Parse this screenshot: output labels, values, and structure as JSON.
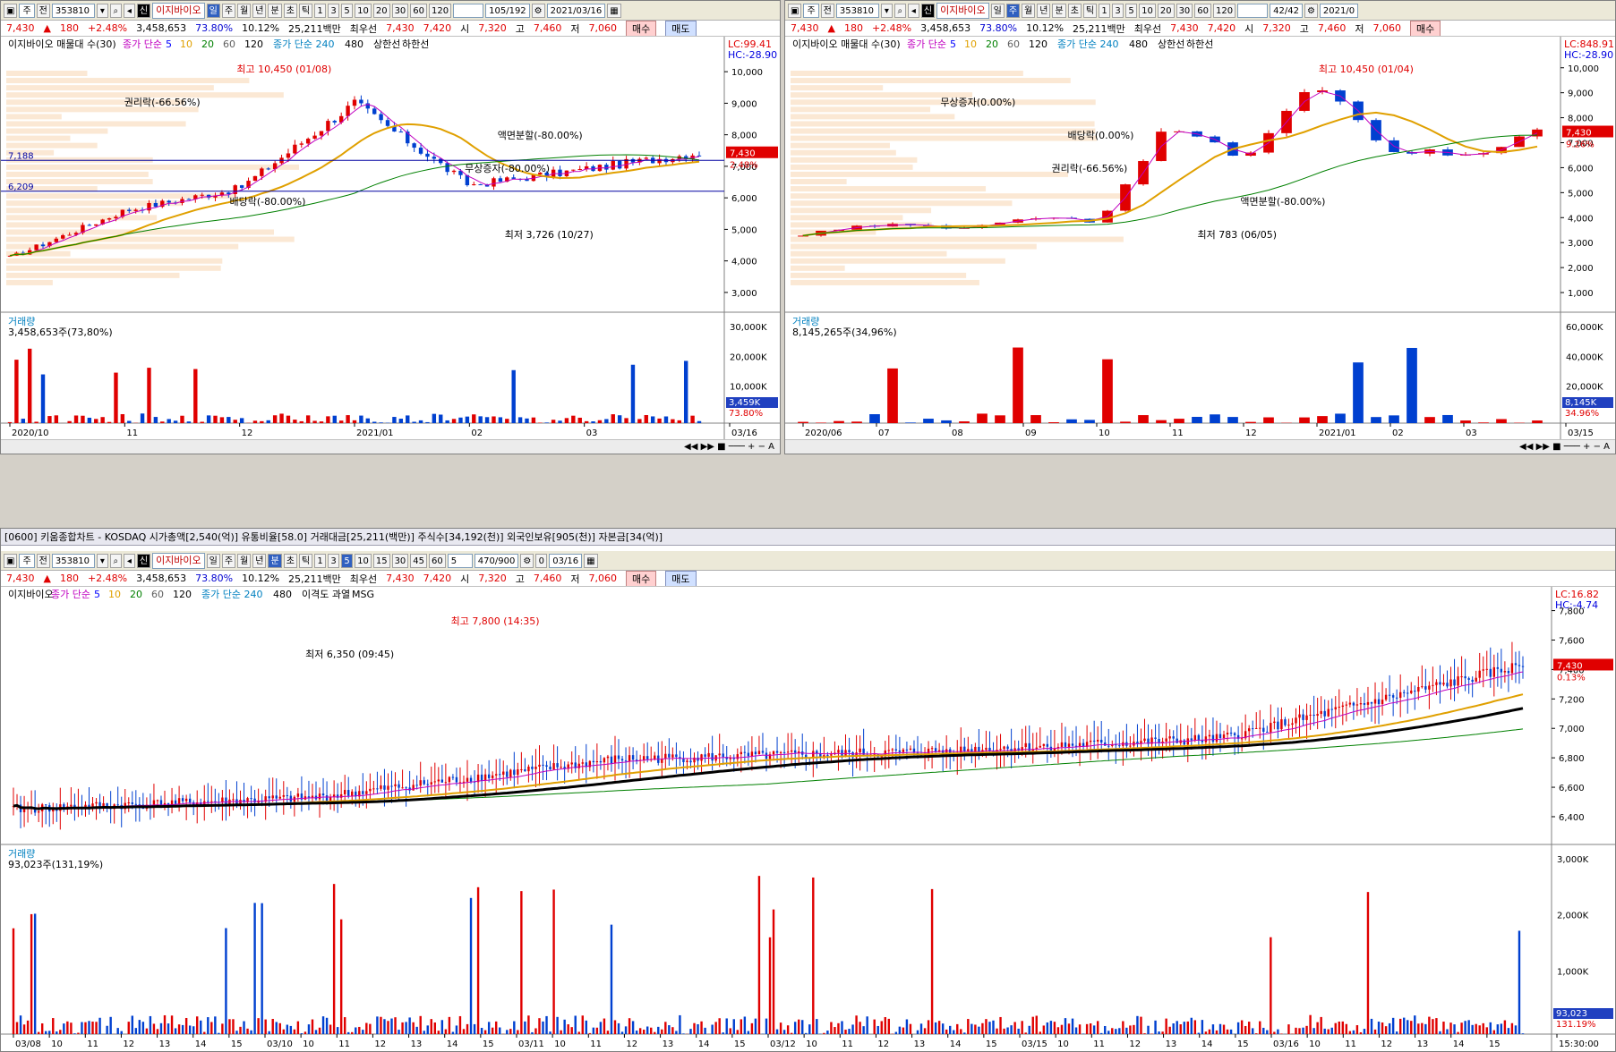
{
  "common": {
    "toolbar_select": "주",
    "toolbar_all": "전",
    "code": "353810",
    "ticker_name": "이지바이오",
    "new_badge": "신",
    "periods": [
      "일",
      "주",
      "월",
      "년",
      "분",
      "초",
      "틱"
    ],
    "numbers_daily": [
      "1",
      "3",
      "5",
      "10",
      "20",
      "30",
      "60",
      "120"
    ],
    "price": "7,430",
    "price_arrow": "▲",
    "change": "180",
    "change_pct": "+2.48%",
    "volume": "3,458,653",
    "vol_ratio": "73.80%",
    "turnover_pct": "10.12%",
    "amount": "25,211백만",
    "priority_label": "최우선",
    "bid": "7,430",
    "ask": "7,420",
    "open_label": "시",
    "open": "7,320",
    "high_label": "고",
    "high": "7,460",
    "low_label": "저",
    "low": "7,060",
    "buy": "매수",
    "sell": "매도"
  },
  "panes": {
    "left": {
      "counter": "105/192",
      "date": "2021/03/16",
      "legend": [
        "이지바이오 매물대 수(30)",
        "종가 단순",
        "5",
        "10",
        "20",
        "60",
        "120",
        "종가 단순 240",
        "480",
        "상한선",
        "하한선"
      ],
      "lc": "LC:99.41",
      "hc": "HC:-28.90",
      "vol_label": "거래량",
      "vol_value": "3,458,653주(73,80%)",
      "vol_side": "3,459K",
      "vol_pct": "73.80%",
      "level1": "7,188",
      "level2": "6,209",
      "cur_price": "7,430",
      "cur_pct": "2.48%",
      "x_labels": [
        "2020/10",
        "11",
        "12",
        "2021/01",
        "02",
        "03",
        "03/16"
      ],
      "y_labels": [
        "10,000",
        "9,000",
        "8,000",
        "7,000",
        "6,000",
        "5,000",
        "4,000",
        "3,000"
      ],
      "vol_y": [
        "30,000K",
        "20,000K",
        "10,000K"
      ],
      "annotations": [
        "최고 10,450 (01/08)",
        "권리락(-66.56%)",
        "액면분할(-80.00%)",
        "무상증자(-80.00%)",
        "배당락(-80.00%)",
        "최저 3,726 (10/27)"
      ]
    },
    "right": {
      "counter": "42/42",
      "date": "2021/0",
      "legend": [
        "이지바이오 매물대 수(30)",
        "종가 단순",
        "5",
        "10",
        "20",
        "60",
        "120",
        "종가 단순 240",
        "480",
        "상한선",
        "하한선"
      ],
      "lc": "LC:848.91",
      "hc": "HC:-28.90",
      "vol_label": "거래량",
      "vol_value": "8,145,265주(34,96%)",
      "vol_side": "8,145K",
      "vol_pct": "34.96%",
      "cur_price": "7,430",
      "cur_pct": "9.26%",
      "x_labels": [
        "2020/06",
        "07",
        "08",
        "09",
        "10",
        "11",
        "12",
        "2021/01",
        "02",
        "03",
        "03/15"
      ],
      "y_labels": [
        "10,000",
        "9,000",
        "8,000",
        "7,000",
        "6,000",
        "5,000",
        "4,000",
        "3,000",
        "2,000",
        "1,000"
      ],
      "vol_y": [
        "60,000K",
        "40,000K",
        "20,000K"
      ],
      "annotations": [
        "최고 10,450 (01/04)",
        "무상증자(0.00%)",
        "배당락(0.00%)",
        "권리락(-66.56%)",
        "액면분할(-80.00%)",
        "최저 783 (06/05)"
      ]
    },
    "bottom": {
      "title": "[0600] 키움종합차트 - KOSDAQ 시가총액[2,540(억)] 유통비율[58.0] 거래대금[25,211(백만)] 주식수[34,192(천)] 외국인보유[905(천)] 자본금[34(억)]",
      "counter": "470/900",
      "interval": "5",
      "date": "03/16",
      "check0": "0",
      "numbers_min": [
        "1",
        "3",
        "5",
        "10",
        "15",
        "30",
        "45",
        "60"
      ],
      "legend": [
        "이지바이오",
        "종가 단순",
        "5",
        "10",
        "20",
        "60",
        "120",
        "종가 단순 240",
        "480",
        "이격도 과열",
        "MSG"
      ],
      "lc": "LC:16.82",
      "hc": "HC:-4.74",
      "vol_label": "거래량",
      "vol_value": "93,023주(131,19%)",
      "vol_side": "93,023",
      "vol_pct": "131.19%",
      "cur_price": "7,430",
      "cur_pct": "0.13%",
      "x_labels": [
        "03/08",
        "10",
        "11",
        "12",
        "13",
        "14",
        "15",
        "03/10",
        "10",
        "11",
        "12",
        "13",
        "14",
        "15",
        "03/11",
        "10",
        "11",
        "12",
        "13",
        "14",
        "15",
        "03/12",
        "10",
        "11",
        "12",
        "13",
        "14",
        "15",
        "03/15",
        "10",
        "11",
        "12",
        "13",
        "14",
        "15",
        "03/16",
        "10",
        "11",
        "12",
        "13",
        "14",
        "15",
        "15:30:00"
      ],
      "y_labels": [
        "7,800",
        "7,600",
        "7,400",
        "7,200",
        "7,000",
        "6,800",
        "6,600",
        "6,400"
      ],
      "vol_y": [
        "3,000K",
        "2,000K",
        "1,000K"
      ],
      "annotations": [
        "최고 7,800 (14:35)",
        "최저 6,350 (09:45)"
      ]
    }
  },
  "chart_data": [
    {
      "type": "candlestick",
      "title": "",
      "x": [
        "2020/10",
        "11",
        "12",
        "2021/01",
        "02",
        "03",
        "03/16"
      ],
      "close": [
        4100,
        5600,
        6300,
        9000,
        6400,
        6900,
        7430
      ],
      "ylim": [
        2600,
        10600
      ],
      "high_point": 10450,
      "low_point": 3726,
      "levels": [
        7188,
        6209
      ]
    },
    {
      "type": "candlestick",
      "title": "",
      "x": [
        "2020/06",
        "07",
        "08",
        "09",
        "10",
        "11",
        "12",
        "2021/01",
        "02",
        "03",
        "03/15"
      ],
      "close": [
        3300,
        3700,
        3600,
        4000,
        3800,
        7800,
        6300,
        9500,
        6700,
        6500,
        7430
      ],
      "ylim": [
        500,
        10600
      ],
      "high_point": 10450,
      "low_point": 783
    },
    {
      "type": "candlestick",
      "title": "",
      "x": [
        "03/08",
        "03/10",
        "03/11",
        "03/12",
        "03/15",
        "03/16"
      ],
      "close": [
        6450,
        6530,
        6790,
        6840,
        6930,
        7430
      ],
      "ylim": [
        6260,
        7840
      ],
      "high_point": 7800,
      "low_point": 6350
    }
  ]
}
